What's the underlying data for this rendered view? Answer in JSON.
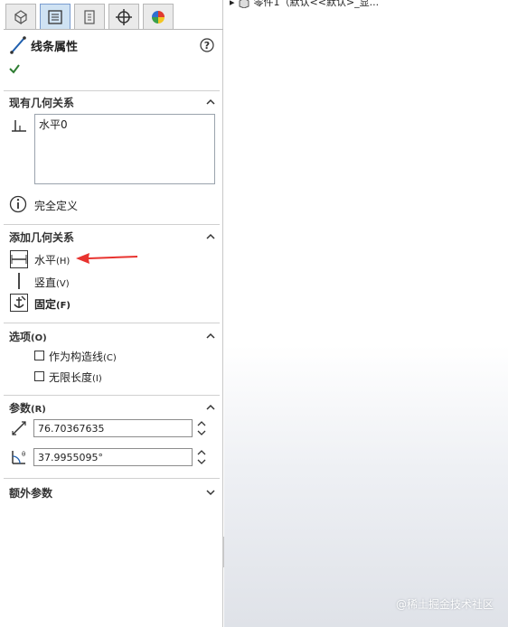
{
  "panel": {
    "title": "线条属性",
    "sections": {
      "existing": {
        "header": "现有几何关系",
        "relations": [
          "水平0"
        ],
        "status": "完全定义"
      },
      "add": {
        "header": "添加几何关系",
        "items": [
          {
            "label": "水平",
            "shortcut": "(H)"
          },
          {
            "label": "竖直",
            "shortcut": "(V)"
          },
          {
            "label": "固定",
            "shortcut": "(F)"
          }
        ]
      },
      "options": {
        "header": "选项",
        "header_shortcut": "(O)",
        "checks": [
          {
            "label": "作为构造线",
            "shortcut": "(C)",
            "checked": false
          },
          {
            "label": "无限长度",
            "shortcut": "(I)",
            "checked": false
          }
        ]
      },
      "params": {
        "header": "参数",
        "header_shortcut": "(R)",
        "length": "76.70367635",
        "angle": "37.9955095°"
      },
      "extra": {
        "header": "额外参数"
      }
    }
  },
  "viewport": {
    "tree_text": "零件1（默认<<默认>_显..."
  },
  "watermark": "@稀土掘金技术社区",
  "colors": {
    "accent": "#2e7d32",
    "arrow": "#e8332f",
    "tab_active": "#cfe2f3"
  }
}
